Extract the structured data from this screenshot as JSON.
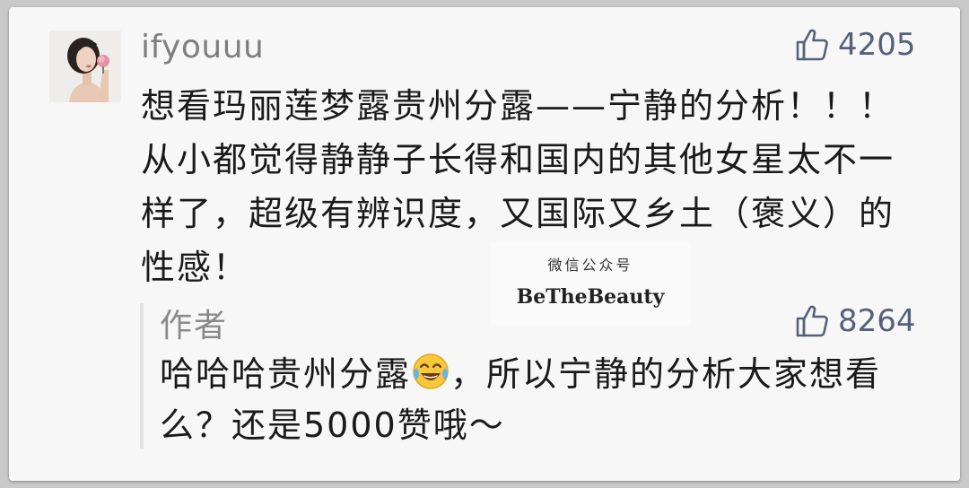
{
  "comment": {
    "username": "ifyouuu",
    "likes": "4205",
    "text": "想看玛丽莲梦露贵州分露——宁静的分析！！！从小都觉得静静子长得和国内的其他女星太不一样了，超级有辨识度，又国际又乡土（褒义）的性感！"
  },
  "reply": {
    "author": "作者",
    "likes": "8264",
    "text_before_emoji": "哈哈哈贵州分露",
    "emoji": "face-with-tears-of-joy",
    "text_after_emoji": "，所以宁静的分析大家想看么？还是5000赞哦～"
  },
  "watermark": {
    "line1": "微信公众号",
    "line2": "BeTheBeauty"
  },
  "colors": {
    "like_color": "#55607a",
    "username_color": "#7f7f7f",
    "text_color": "#1a1a1a"
  },
  "icons": {
    "like": "thumbs-up-icon"
  }
}
